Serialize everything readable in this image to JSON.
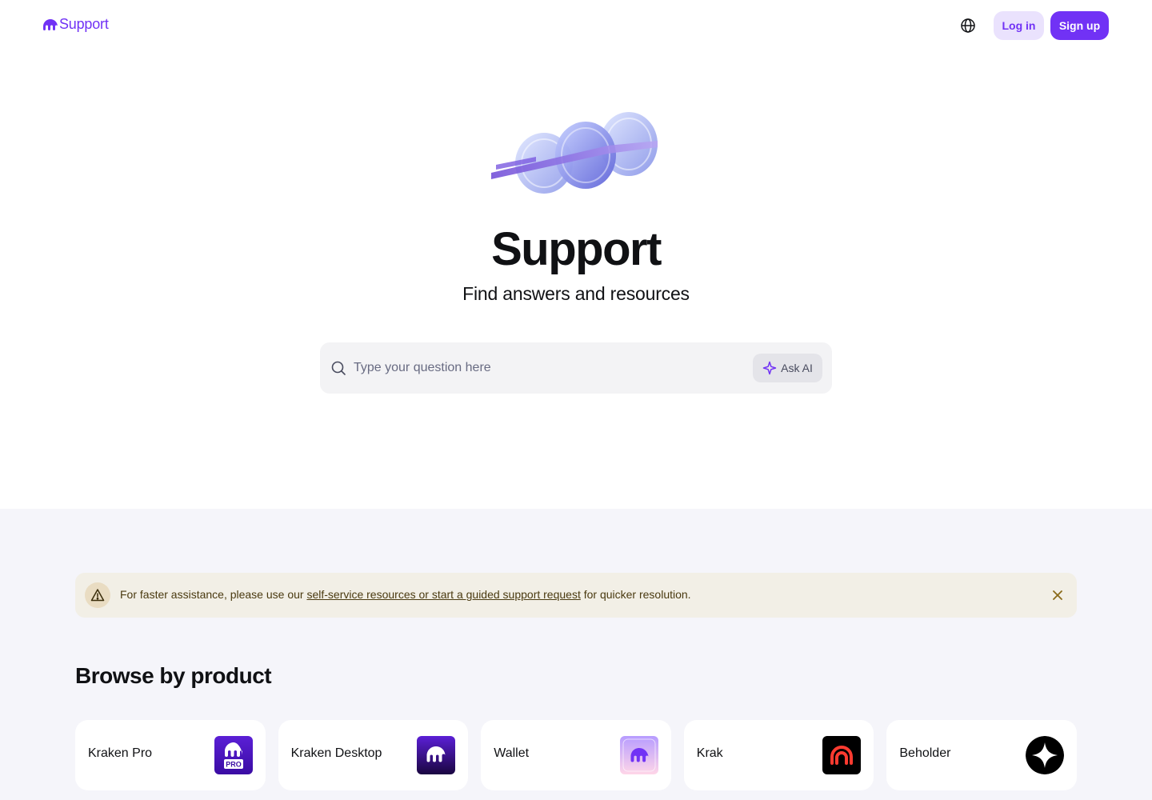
{
  "header": {
    "logo_text": "Support",
    "globe_icon": "globe-icon",
    "login_label": "Log in",
    "signup_label": "Sign up"
  },
  "hero": {
    "illustration": "coins-illustration",
    "title": "Support",
    "subtitle": "Find answers and resources"
  },
  "search": {
    "placeholder": "Type your question here",
    "value": "",
    "icon": "search-icon",
    "ask_ai_label": "Ask AI",
    "ask_ai_icon": "sparkle-icon"
  },
  "notice": {
    "icon": "warning-icon",
    "text_before": "For faster assistance, please use our ",
    "link_text": "self-service resources or start a guided support request",
    "text_after": " for quicker resolution.",
    "close_icon": "close-icon"
  },
  "browse": {
    "title": "Browse by product",
    "products": [
      {
        "label": "Kraken Pro",
        "icon": "kraken-pro-icon",
        "badge": "PRO"
      },
      {
        "label": "Kraken Desktop",
        "icon": "kraken-desktop-icon"
      },
      {
        "label": "Wallet",
        "icon": "wallet-icon"
      },
      {
        "label": "Krak",
        "icon": "krak-icon"
      },
      {
        "label": "Beholder",
        "icon": "beholder-icon"
      }
    ]
  },
  "colors": {
    "brand": "#7132f5",
    "brand_light": "#eae2fd",
    "lower_bg": "#f5f5fa",
    "notice_bg": "#f2efe6",
    "krak_red": "#ff3b30"
  }
}
